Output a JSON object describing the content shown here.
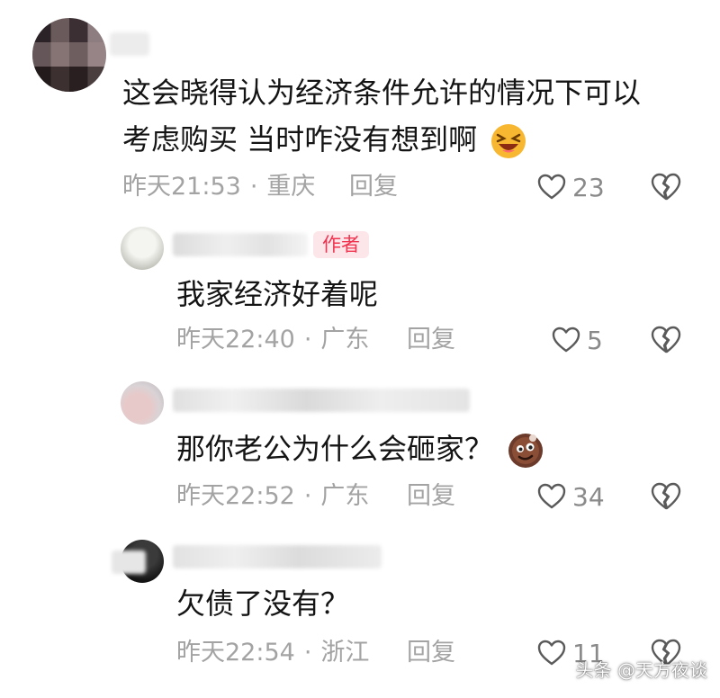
{
  "comments": [
    {
      "lines": [
        "这会晓得认为经济条件允许的情况下可以",
        "考虑购买 当时咋没有想到啊"
      ],
      "emoji": "laughing-face-emoji",
      "time": "昨天21:53",
      "location": "重庆",
      "reply": "回复",
      "likes": "23"
    },
    {
      "badge": "作者",
      "text": "我家经济好着呢",
      "time": "昨天22:40",
      "location": "广东",
      "reply": "回复",
      "likes": "5"
    },
    {
      "text": "那你老公为什么会砸家？",
      "emoji": "cookie-face-emoji",
      "time": "昨天22:52",
      "location": "广东",
      "reply": "回复",
      "likes": "34"
    },
    {
      "text": "欠债了没有？",
      "time": "昨天22:54",
      "location": "浙江",
      "reply": "回复",
      "likes": "11"
    }
  ],
  "separator": "·",
  "watermark": "头条 @天方夜谈",
  "colors": {
    "text": "#141414",
    "meta": "#a3a3a3",
    "badge_bg": "#fde6ea",
    "badge_text": "#f0344f"
  }
}
